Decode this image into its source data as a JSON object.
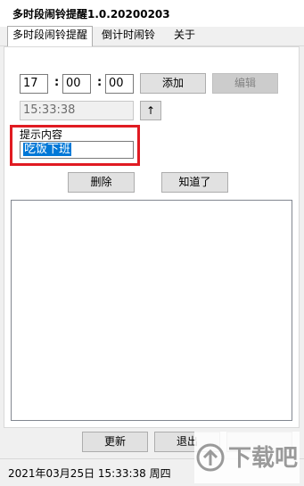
{
  "window": {
    "title": "多时段闹铃提醒1.0.20200203"
  },
  "tabs": [
    {
      "label": "多时段闹铃提醒",
      "active": true
    },
    {
      "label": "倒计时闹铃",
      "active": false
    },
    {
      "label": "关于",
      "active": false
    }
  ],
  "alarm": {
    "hour": "17",
    "minute": "00",
    "second": "00",
    "colon": ":",
    "add_label": "添加",
    "edit_label": "编辑",
    "current_time": "15:33:38",
    "up_label": "↑",
    "reminder_label": "提示内容",
    "reminder_value": "吃饭下班",
    "delete_label": "删除",
    "ack_label": "知道了"
  },
  "bottom": {
    "refresh_label": "更新",
    "exit_label": "退出"
  },
  "status": {
    "text": "2021年03月25日 15:33:38 周四"
  },
  "watermark": {
    "text": "下载吧"
  },
  "colors": {
    "highlight": "#e01b22",
    "selection": "#0078d7"
  }
}
